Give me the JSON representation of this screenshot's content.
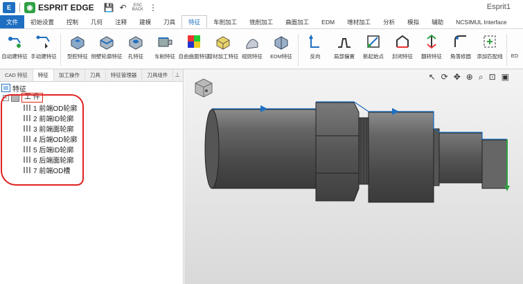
{
  "titlebar": {
    "brand": "ESPRIT EDGE",
    "hint": "ESC\nBACK",
    "doc_title": "Esprit1"
  },
  "menu": {
    "tabs": [
      "文件",
      "初始设置",
      "控制",
      "几何",
      "注释",
      "建模",
      "刀具",
      "特征",
      "车削加工",
      "铣削加工",
      "曲面加工",
      "EDM",
      "增材加工",
      "分析",
      "模拟",
      "辅助",
      "NCSIMUL Interface"
    ],
    "active_index": 7
  },
  "ribbon": {
    "buttons": [
      "自动建特征",
      "手动建特征",
      "型腔特征",
      "侧壁轮廓特征",
      "孔特征",
      "车削特征",
      "自由曲面特征",
      "增材加工特征",
      "规则特征",
      "EDM特征",
      "反向",
      "局部偏置",
      "新起始点",
      "封闭特征",
      "翻转特征",
      "角落修圆",
      "添加匹配线",
      "ED"
    ]
  },
  "panel": {
    "tabs": [
      "CAD 特征",
      "特征",
      "加工操作",
      "刀具",
      "特征管理器",
      "刀具组件"
    ],
    "active_index": 1,
    "pin_icon": "pin-icon"
  },
  "tree": {
    "root_label": "特征",
    "workpiece_label": "工 件",
    "expand_symbol": "−",
    "items": [
      "1 前端OD轮廓",
      "2 前端ID轮廓",
      "3 前端面轮廓",
      "4 后端OD轮廓",
      "5 后端ID轮廓",
      "6 后端面轮廓",
      "7 前端OD槽"
    ]
  },
  "colors": {
    "accent": "#1e6fc2",
    "annotation_red": "#e02020",
    "part_gray": "#595959"
  }
}
